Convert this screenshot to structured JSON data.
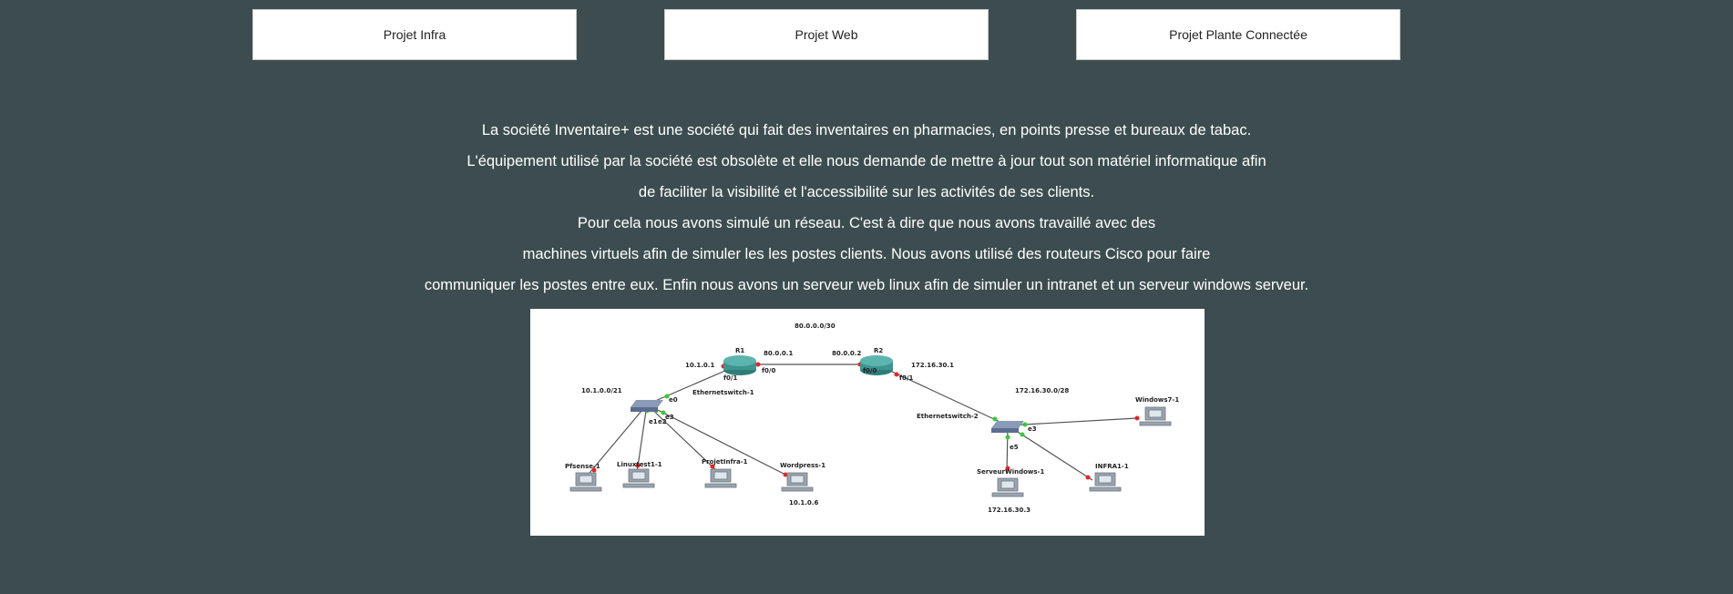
{
  "nav": {
    "buttons": [
      "Projet Infra",
      "Projet Web",
      "Projet Plante Connectée"
    ]
  },
  "intro": {
    "lines": [
      "La société Inventaire+ est une société qui fait des inventaires en pharmacies, en points presse et bureaux de tabac.",
      "L'équipement utilisé par la société est obsolète et elle nous demande de mettre à jour tout son matériel informatique afin",
      "de faciliter la visibilité et l'accessibilité sur les activités de ses clients.",
      "Pour cela nous avons simulé un réseau. C'est à dire que nous avons travaillé avec des",
      "machines virtuels afin de simuler les les postes clients. Nous avons utilisé des routeurs Cisco pour faire",
      "communiquer les postes entre eux. Enfin nous avons un serveur web linux afin de simuler un intranet et un serveur windows serveur."
    ]
  },
  "diagram": {
    "labels": {
      "wan": "80.0.0.0/30",
      "r1": "R1",
      "r2": "R2",
      "r1_ip": "80.0.0.1",
      "r2_ip": "80.0.0.2",
      "lan1_gw": "10.1.0.1",
      "lan2_gw": "172.16.30.1",
      "r1_f00": "f0/0",
      "r1_f01": "f0/1",
      "r2_f00": "f0/0",
      "r2_f01": "f0/1",
      "lan1_net": "10.1.0.0/21",
      "lan2_net": "172.16.30.0/28",
      "sw1": "Ethernetswitch-1",
      "sw2": "Ethernetswitch-2",
      "pc1": "Pfsense-1",
      "pc2": "Linuxtest1-1",
      "pc3": "ProjetInfra-1",
      "pc4": "Wordpress-1",
      "pc4_ip": "10.1.0.6",
      "pc5": "Windows7-1",
      "pc6": "ServeurWindows-1",
      "pc6_ip": "172.16.30.3",
      "pc7": "INFRA1-1",
      "e0": "e0",
      "e1": "e1",
      "e2": "e2",
      "e3": "e3",
      "e5": "e5"
    }
  }
}
